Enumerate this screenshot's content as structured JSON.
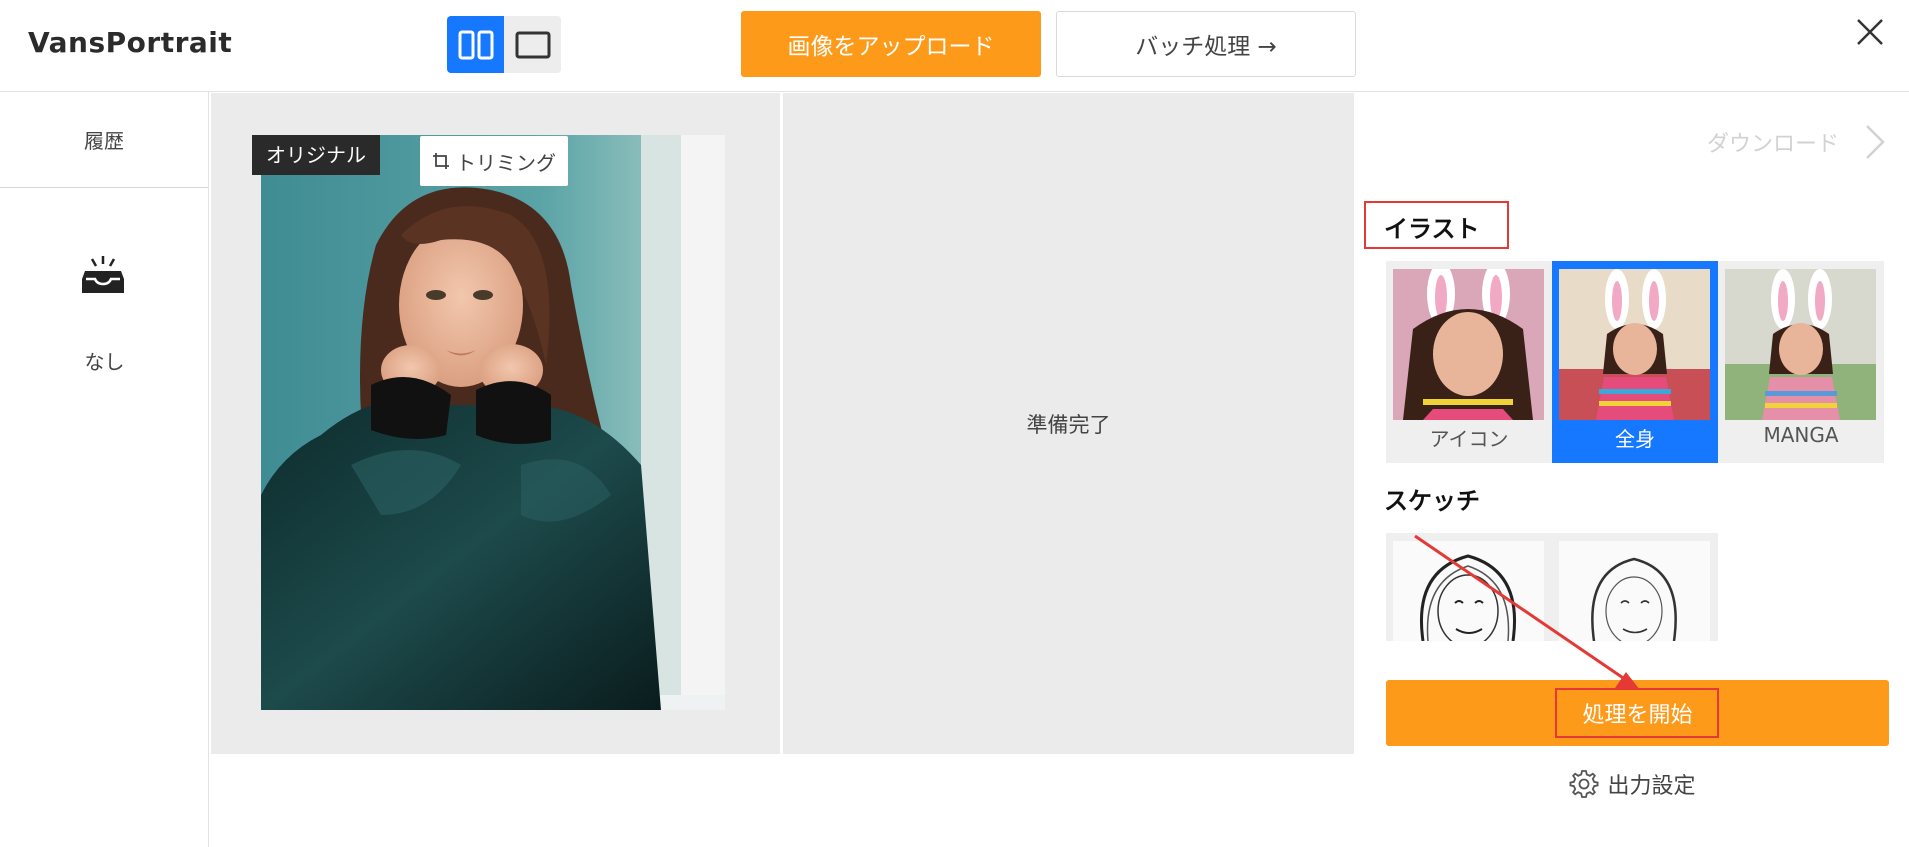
{
  "app": {
    "title": "VansPortrait"
  },
  "header": {
    "upload_label": "画像をアップロード",
    "batch_label": "バッチ処理 →"
  },
  "sidebar": {
    "history_label": "履歴",
    "empty_label": "なし"
  },
  "preview": {
    "original_badge": "オリジナル",
    "crop_label": "トリミング",
    "ready_text": "準備完了"
  },
  "settings": {
    "download_label": "ダウンロード",
    "illust_title": "イラスト",
    "illust_styles": [
      {
        "label": "アイコン",
        "selected": false
      },
      {
        "label": "全身",
        "selected": true
      },
      {
        "label": "MANGA",
        "selected": false
      }
    ],
    "sketch_title": "スケッチ",
    "start_label": "処理を開始",
    "output_settings_label": "出力設定"
  },
  "colors": {
    "accent_orange": "#fd9a1a",
    "accent_blue": "#1677ff",
    "annotation_red": "#e53935"
  }
}
